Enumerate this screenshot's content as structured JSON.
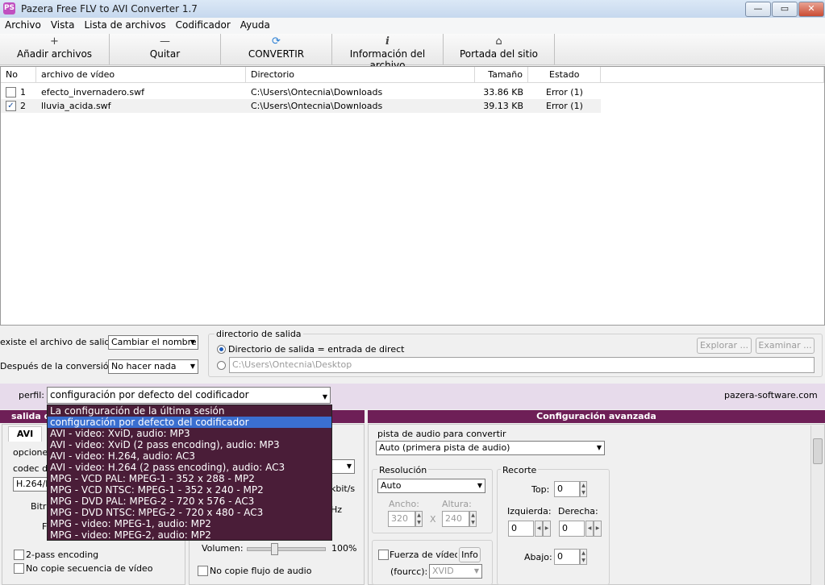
{
  "window": {
    "title": "Pazera Free FLV to AVI Converter 1.7",
    "icon_text": "PS",
    "controls": {
      "minimize": "—",
      "maximize": "▭",
      "close": "✕"
    }
  },
  "menu": [
    "Archivo",
    "Vista",
    "Lista de archivos",
    "Codificador",
    "Ayuda"
  ],
  "toolbar": [
    {
      "label": "Añadir archivos",
      "icon": "+"
    },
    {
      "label": "Quitar",
      "icon": "—"
    },
    {
      "label": "CONVERTIR",
      "icon": "⟳"
    },
    {
      "label": "Información del archivo",
      "icon": "i"
    },
    {
      "label": "Portada del sitio",
      "icon": "⌂"
    }
  ],
  "filelist": {
    "columns": [
      "No",
      "archivo de vídeo",
      "Directorio",
      "Tamaño",
      "Estado"
    ],
    "rows": [
      {
        "checked": false,
        "no": "1",
        "file": "efecto_invernadero.swf",
        "dir": "C:\\Users\\Ontecnia\\Downloads",
        "size": "33.86 KB",
        "status": "Error (1)"
      },
      {
        "checked": true,
        "no": "2",
        "file": "lluvia_acida.swf",
        "dir": "C:\\Users\\Ontecnia\\Downloads",
        "size": "39.13 KB",
        "status": "Error (1)"
      }
    ]
  },
  "output": {
    "exists_label": "existe el archivo de salida:",
    "exists_value": "Cambiar el nombre",
    "after_label": "Después de la conversión:",
    "after_value": "No hacer nada",
    "dir_group": "directorio de salida",
    "radio_same": "Directorio de salida = entrada de direct",
    "custom_dir": "C:\\Users\\Ontecnia\\Desktop",
    "explore_btn": "Explorar ...",
    "browse_btn": "Examinar ..."
  },
  "profile": {
    "label": "perfil:",
    "value": "configuración por defecto del codificador",
    "site": "pazera-software.com",
    "options": [
      "La configuración de la última sesión",
      "configuración por defecto del codificador",
      "AVI - video: XviD, audio: MP3",
      "AVI - video: XviD (2 pass encoding), audio: MP3",
      "AVI - video: H.264, audio: AC3",
      "AVI - video: H.264 (2 pass encoding), audio: AC3",
      "MPG - VCD PAL: MPEG-1 - 352 x 288 - MP2",
      "MPG - VCD NTSC: MPEG-1 - 352 x 240 - MP2",
      "MPG - DVD PAL: MPEG-2 - 720 x 576 - AC3",
      "MPG - DVD NTSC: MPEG-2 - 720 x 480 - AC3",
      "MPG - video: MPEG-1, audio: MP2",
      "MPG - video: MPEG-2, audio: MP2"
    ]
  },
  "left_panel": {
    "head": "salida d",
    "tab": "AVI",
    "options_label": "opciones",
    "codec_label": "codec de",
    "codec_value": "H.264/M",
    "bitrate_label": "Bitra",
    "f_label": "F",
    "two_pass": "2-pass encoding",
    "no_copy_video": "No copie secuencia de vídeo"
  },
  "mid_panel": {
    "kbits": "kbit/s",
    "hz": "Hz",
    "volume_label": "Volumen:",
    "volume_value": "100%",
    "volume_level": 0.33,
    "no_copy_audio": "No copie flujo de audio"
  },
  "right_panel": {
    "head": "Configuración avanzada",
    "audio_track_label": "pista de audio para convertir",
    "audio_track_value": "Auto (primera pista de audio)",
    "resolution_label": "Resolución",
    "resolution_value": "Auto",
    "width_label": "Ancho:",
    "height_label": "Altura:",
    "width_value": "320",
    "height_value": "240",
    "x_sep": "X",
    "crop_label": "Recorte",
    "top_label": "Top:",
    "top_value": "0",
    "left_label": "Izquierda:",
    "left_value": "0",
    "right_label": "Derecha:",
    "right_value": "0",
    "bottom_label": "Abajo:",
    "bottom_value": "0",
    "force_video": "Fuerza de vídeo c",
    "info_btn": "Info",
    "fourcc_label": "(fourcc):",
    "fourcc_value": "XVID"
  }
}
